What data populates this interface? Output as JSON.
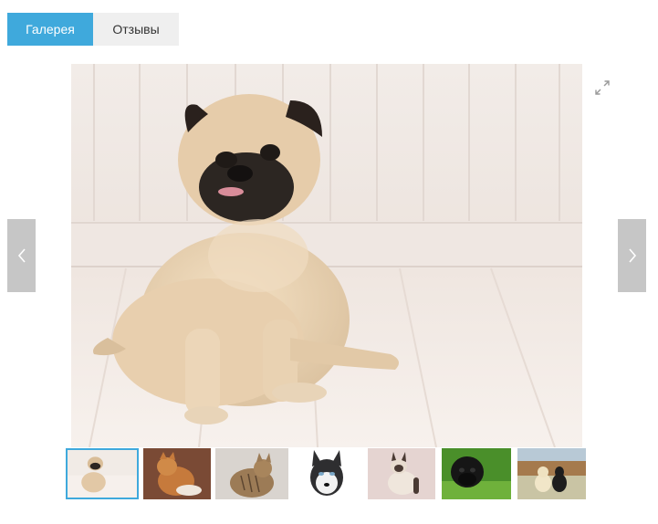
{
  "tabs": [
    {
      "label": "Галерея",
      "active": true
    },
    {
      "label": "Отзывы",
      "active": false
    }
  ],
  "gallery": {
    "main_image": "pug-sitting",
    "selected_index": 0,
    "expand_icon": "expand-icon",
    "prev_icon": "chevron-left-icon",
    "next_icon": "chevron-right-icon",
    "thumbnails": [
      "pug",
      "orange-cat",
      "tabby-cat",
      "husky",
      "siamese-cat",
      "black-pug",
      "labradors"
    ]
  },
  "colors": {
    "accent": "#3fa9dc",
    "arrow_bg": "#c6c6c6",
    "tab_inactive_bg": "#efefef"
  }
}
